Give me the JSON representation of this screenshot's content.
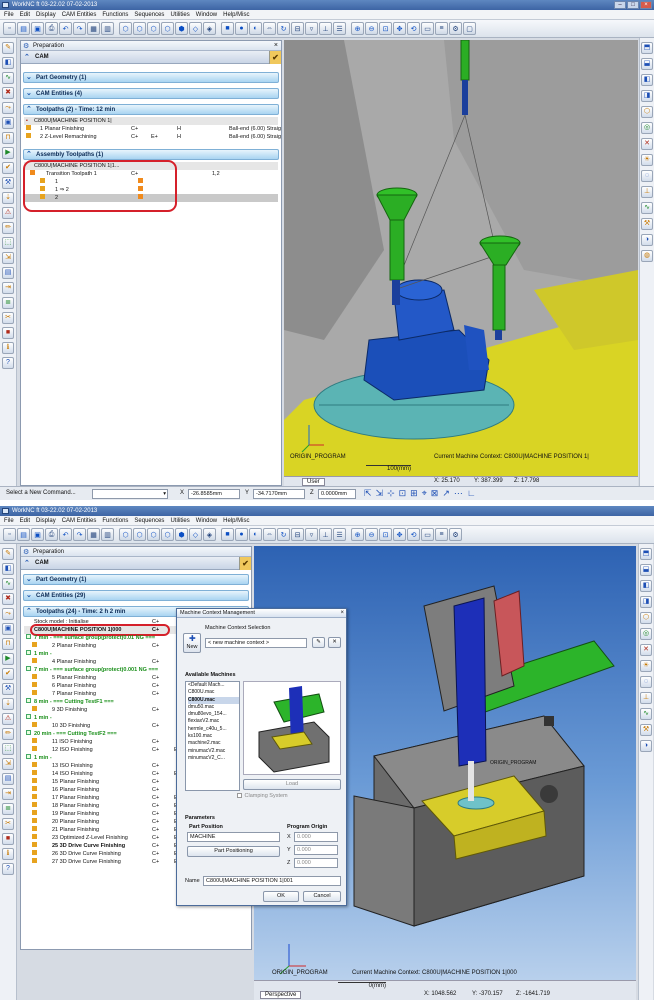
{
  "top": {
    "title": "WorkNC  ft 03-22.02   07-02-2013",
    "menu": [
      "File",
      "Edit",
      "Display",
      "CAM Entities",
      "Functions",
      "Sequences",
      "Utilities",
      "Window",
      "Help/Misc"
    ],
    "panel_title": "Preparation",
    "cam_label": "CAM",
    "sections": {
      "part_geometry": "Part Geometry (1)",
      "cam_entities": "CAM Entities (4)",
      "toolpaths": "Toolpaths (2) - Time: 12 min",
      "assembly": "Assembly Toolpaths (1)"
    },
    "toolpath_group": "C800U|MACHINE POSITION 1|",
    "toolpaths": [
      {
        "name": "1 Planar Finishing",
        "ax": "C+",
        "mode": "H",
        "tool": "Ball-end (6.00) Straig..."
      },
      {
        "name": "2 Z-Level Remachining",
        "ax": "C+",
        "ax2": "E+",
        "mode": "H",
        "tool": "Ball-end (6.00) Straig..."
      }
    ],
    "assembly_group": "C800U|MACHINE POSITION 1|1...",
    "transition": {
      "name": "Transition Toolpath 1",
      "ax": "C+",
      "value": "1,2"
    },
    "transition_children": [
      "1",
      "1 ⇒ 2",
      "2"
    ],
    "viewport": {
      "origin_label": "ORIGIN_PROGRAM",
      "context": "Current Machine Context: C800U|MACHINE POSITION 1|",
      "scale": "100(mm)",
      "coords": {
        "x": "X: 25.170",
        "y": "Y: 387.399",
        "z": "Z: 17.798"
      },
      "view_tab": "User"
    },
    "bottom": {
      "prompt": "Select a New Command...",
      "x": "-26.8585mm",
      "y": "-34.7170mm",
      "z": "0.0000mm",
      "x_label": "X",
      "y_label": "Y",
      "z_label": "Z"
    }
  },
  "bottom": {
    "title": "WorkNC  ft 03-22.02   07-02-2013",
    "menu": [
      "File",
      "Edit",
      "Display",
      "CAM Entities",
      "Functions",
      "Sequences",
      "Utilities",
      "Window",
      "Help/Misc"
    ],
    "panel_title": "Preparation",
    "cam_label": "CAM",
    "sections": {
      "part_geometry": "Part Geometry (1)",
      "cam_entities": "CAM Entities (29)",
      "toolpaths": "Toolpaths (24) - Time: 2 h 2 min"
    },
    "stock_row": {
      "name": "Stock model : Initialise",
      "ax": "C+"
    },
    "position_row": {
      "name": "C800U|MACHINE POSITION 1|000",
      "ax": "C+"
    },
    "rows": [
      {
        "text": "7 min - === surface group(protect)0.01  NG ===",
        "kind": "group"
      },
      {
        "text": "2 Planar Finishing",
        "ax": "C+"
      },
      {
        "text": "1 min -",
        "kind": "group"
      },
      {
        "text": "4 Planar Finishing",
        "ax": "C+"
      },
      {
        "text": "7 min - === surface group(protect)0.001  NG ===",
        "kind": "group"
      },
      {
        "text": "5 Planar Finishing",
        "ax": "C+"
      },
      {
        "text": "6 Planar Finishing",
        "ax": "C+"
      },
      {
        "text": "7 Planar Finishing",
        "ax": "C+"
      },
      {
        "text": "8 min - === Cutting TestF1 ===",
        "kind": "group"
      },
      {
        "text": "9 3D Finishing",
        "ax": "C+"
      },
      {
        "text": "1 min -",
        "kind": "group"
      },
      {
        "text": "10 3D Finishing",
        "ax": "C+"
      },
      {
        "text": "20 min - === Cutting TestF2 ===",
        "kind": "group"
      },
      {
        "text": "11 ISO Finishing",
        "ax": "C+"
      },
      {
        "text": "12 ISO Finishing",
        "ax": "C+",
        "ax2": "E+"
      },
      {
        "text": "1 min -",
        "kind": "group"
      },
      {
        "text": "13 ISO Finishing",
        "ax": "C+"
      },
      {
        "text": "14 ISO Finishing",
        "ax": "C+",
        "ax2": "E+"
      },
      {
        "text": "15 Planar Finishing",
        "ax": "C+"
      },
      {
        "text": "16 Planar Finishing",
        "ax": "C+"
      },
      {
        "text": "17 Planar Finishing",
        "ax": "C+",
        "ax2": "E+"
      },
      {
        "text": "18 Planar Finishing",
        "ax": "C+",
        "ax2": "E+"
      },
      {
        "text": "19 Planar Finishing",
        "ax": "C+",
        "ax2": "E+"
      },
      {
        "text": "20 Planar Finishing",
        "ax": "C+",
        "ax2": "E+"
      },
      {
        "text": "21 Planar Finishing",
        "ax": "C+",
        "ax2": "E+"
      },
      {
        "text": "23 Optimized Z-Level Finishing",
        "ax": "C+",
        "ax2": "E+",
        "tool": "Bal..."
      },
      {
        "text": "25 3D Drive Curve Finishing",
        "ax": "C+",
        "ax2": "E+",
        "tool": "Bal...",
        "bold": true
      },
      {
        "text": "26 3D Drive Curve Finishing",
        "ax": "C+",
        "ax2": "E+",
        "tool": "Bal..."
      },
      {
        "text": "27 3D Drive Curve Finishing",
        "ax": "C+",
        "ax2": "E+",
        "tool": "Bal..."
      }
    ],
    "dialog": {
      "title": "Machine Context Management",
      "section": "Machine Context Selection",
      "new_label": "New",
      "select_value": "< new machine context >",
      "available": "Available Machines",
      "machines": [
        "<Default Mach...",
        "C800U.mac",
        "C800U.mac",
        "dmu50.mac",
        "dmu80evo_154...",
        "flexiaxV2.mac",
        "hermle_c40u_5...",
        "ks100.mac",
        "machine2.mac",
        "minumacV2.mac",
        "minumacV2_C..."
      ],
      "selected_index": 2,
      "load": "Load",
      "clamping": "Clamping System",
      "parameters": "Parameters",
      "part_position": "Part Position",
      "program_origin": "Program Origin",
      "position_value": "MACHINE",
      "part_positioning": "Part Positioning",
      "x": "0.000",
      "y": "0.000",
      "z": "0.000",
      "x_label": "X",
      "y_label": "Y",
      "z_label": "Z",
      "name_label": "Name",
      "name_value": "C800U|MACHINE POSITION 1|001",
      "ok": "OK",
      "cancel": "Cancel"
    },
    "viewport": {
      "origin_label": "ORIGIN_PROGRAM",
      "context": "Current Machine Context: C800U|MACHINE POSITION 1|000",
      "scale": "0(mm)",
      "coords": {
        "x": "X: 1048.562",
        "y": "Y: -370.157",
        "z": "Z: -1641.719"
      },
      "view_tab": "Perspective",
      "part_label": "ORIGIN_PROGRAM"
    }
  }
}
